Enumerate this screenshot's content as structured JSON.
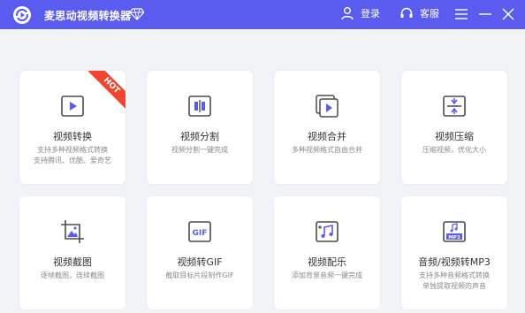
{
  "app": {
    "title": "麦思动视频转换器",
    "login_label": "登录",
    "service_label": "客服",
    "accent_color": "#5a5cf0",
    "icon_color": "#5a5cf0"
  },
  "cards": [
    {
      "title": "视频转换",
      "desc": "支持多种视频格式转换\n支持腾讯、优酷、爱奇艺",
      "badge": "HOT",
      "icon": "video-convert-icon"
    },
    {
      "title": "视频分割",
      "desc": "视频分割一键完成",
      "icon": "video-split-icon"
    },
    {
      "title": "视频合并",
      "desc": "多种视频格式自由合并",
      "icon": "video-merge-icon"
    },
    {
      "title": "视频压缩",
      "desc": "压缩视频，优化大小",
      "icon": "video-compress-icon"
    },
    {
      "title": "视频截图",
      "desc": "逐帧截图，连续截图",
      "icon": "video-screenshot-icon"
    },
    {
      "title": "视频转GIF",
      "desc": "截取目标片段制作GIF",
      "icon": "gif-icon"
    },
    {
      "title": "视频配乐",
      "desc": "添加背景音频一键完成",
      "icon": "music-note-icon"
    },
    {
      "title": "音频/视频转MP3",
      "desc": "支持多种音频格式转换\n单独提取视频的声音",
      "icon": "mp3-icon"
    }
  ]
}
